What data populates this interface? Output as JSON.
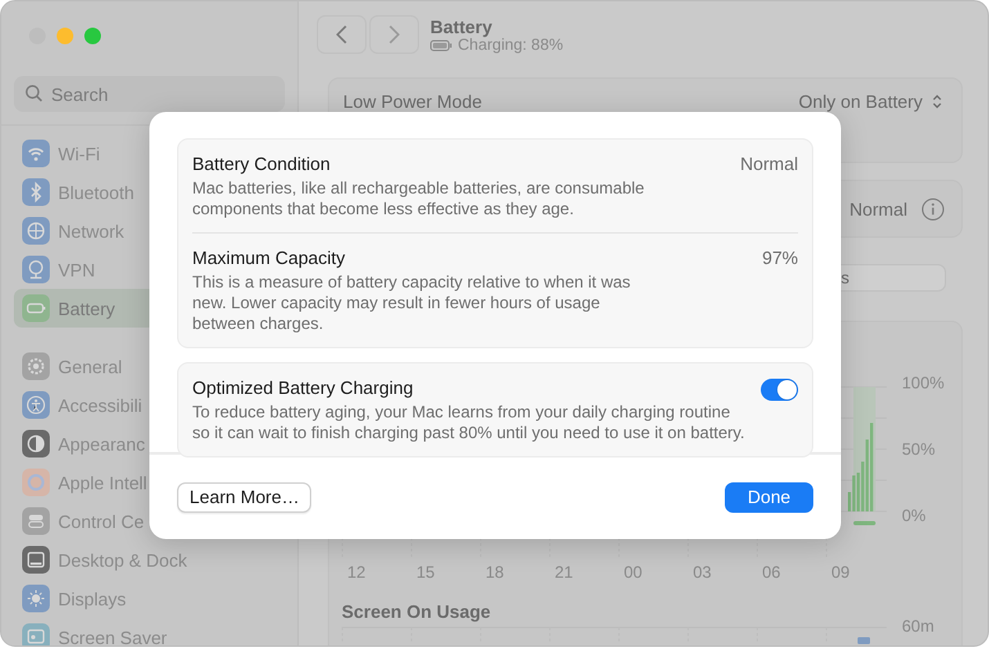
{
  "sidebar": {
    "search": {
      "placeholder": "Search"
    },
    "groups": [
      [
        {
          "label": "Wi-Fi",
          "selected": false
        },
        {
          "label": "Bluetooth",
          "selected": false
        },
        {
          "label": "Network",
          "selected": false
        },
        {
          "label": "VPN",
          "selected": false
        },
        {
          "label": "Battery",
          "selected": true
        }
      ],
      [
        {
          "label": "General",
          "selected": false
        },
        {
          "label": "Accessibili",
          "selected": false
        },
        {
          "label": "Appearanc",
          "selected": false
        },
        {
          "label": "Apple Intell",
          "selected": false
        },
        {
          "label": "Control Ce",
          "selected": false
        },
        {
          "label": "Desktop & Dock",
          "selected": false
        },
        {
          "label": "Displays",
          "selected": false
        },
        {
          "label": "Screen Saver",
          "selected": false
        }
      ]
    ]
  },
  "header": {
    "title": "Battery",
    "subtitle": "Charging: 88%"
  },
  "settings": {
    "low_power_mode": {
      "label": "Low Power Mode",
      "value": "Only on Battery"
    },
    "battery_health": {
      "value": "Normal"
    },
    "segment": {
      "label": "s"
    }
  },
  "level_chart": {
    "y_labels": [
      "100%",
      "50%",
      "0%"
    ],
    "x_labels": [
      "12",
      "15",
      "18",
      "21",
      "00",
      "03",
      "06",
      "09"
    ]
  },
  "screen_usage": {
    "title": "Screen On Usage",
    "y_label": "60m"
  },
  "dialog": {
    "sections": [
      {
        "items": [
          {
            "kind": "value",
            "title": "Battery Condition",
            "value": "Normal",
            "description": "Mac batteries, like all rechargeable batteries, are consumable components that become less effective as they age."
          },
          {
            "kind": "value",
            "title": "Maximum Capacity",
            "value": "97%",
            "description": "This is a measure of battery capacity relative to when it was new. Lower capacity may result in fewer hours of usage between charges."
          }
        ]
      },
      {
        "items": [
          {
            "kind": "toggle",
            "title": "Optimized Battery Charging",
            "on": true,
            "description": "To reduce battery aging, your Mac learns from your daily charging routine so it can wait to finish charging past 80% until you need to use it on battery."
          }
        ]
      }
    ],
    "buttons": [
      {
        "label": "Learn More…",
        "kind": "secondary"
      },
      {
        "label": "Done",
        "kind": "primary"
      }
    ]
  }
}
